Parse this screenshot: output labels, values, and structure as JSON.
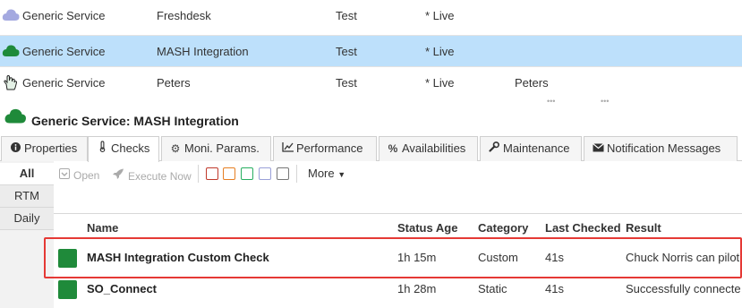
{
  "services": [
    {
      "icon": "cloud-lavender-icon",
      "type": "Generic Service",
      "name": "Freshdesk",
      "environment": "Test",
      "state": "* Live",
      "owner": ""
    },
    {
      "icon": "cloud-green-icon",
      "type": "Generic Service",
      "name": "MASH Integration",
      "environment": "Test",
      "state": "* Live",
      "owner": ""
    },
    {
      "icon": "hand-icon",
      "type": "Generic Service",
      "name": "Peters",
      "environment": "Test",
      "state": "* Live",
      "owner": "Peters"
    }
  ],
  "detail": {
    "title": "Generic Service: MASH Integration",
    "icon": "cloud-green-icon"
  },
  "tabs": [
    {
      "label": "Properties",
      "icon": "info-icon",
      "glyph": "ℹ"
    },
    {
      "label": "Checks",
      "icon": "thermometer-icon",
      "glyph": "🌡"
    },
    {
      "label": "Moni. Params.",
      "icon": "gear-icon",
      "glyph": "⚙"
    },
    {
      "label": "Performance",
      "icon": "chart-icon",
      "glyph": "📈"
    },
    {
      "label": "Availabilities",
      "icon": "percent-icon",
      "glyph": "%"
    },
    {
      "label": "Maintenance",
      "icon": "wrench-icon",
      "glyph": "🔧"
    },
    {
      "label": "Notification Messages",
      "icon": "envelope-icon",
      "glyph": "✉"
    }
  ],
  "active_tab": "Checks",
  "filters": [
    "All",
    "RTM",
    "Daily"
  ],
  "active_filter": "All",
  "toolbar": {
    "open_label": "Open",
    "execute_label": "Execute Now",
    "more_label": "More",
    "status_filter_colors": [
      "#c0392b",
      "#e67e22",
      "#27ae60",
      "#9aa0d8",
      "#777777"
    ]
  },
  "table": {
    "columns": [
      "Name",
      "Status Age",
      "Category",
      "Last Checked",
      "Result"
    ],
    "rows": [
      {
        "status_color": "#1f8a3a",
        "name": "MASH Integration Custom Check",
        "status_age": "1h 15m",
        "category": "Custom",
        "last_checked": "41s",
        "result": "Chuck Norris can pilot"
      },
      {
        "status_color": "#1f8a3a",
        "name": "SO_Connect",
        "status_age": "1h 28m",
        "category": "Static",
        "last_checked": "41s",
        "result": "Successfully connecte"
      }
    ]
  },
  "colors": {
    "selected_row": "#bde0fb",
    "highlight": "#e53935",
    "status_ok": "#1f8a3a"
  }
}
